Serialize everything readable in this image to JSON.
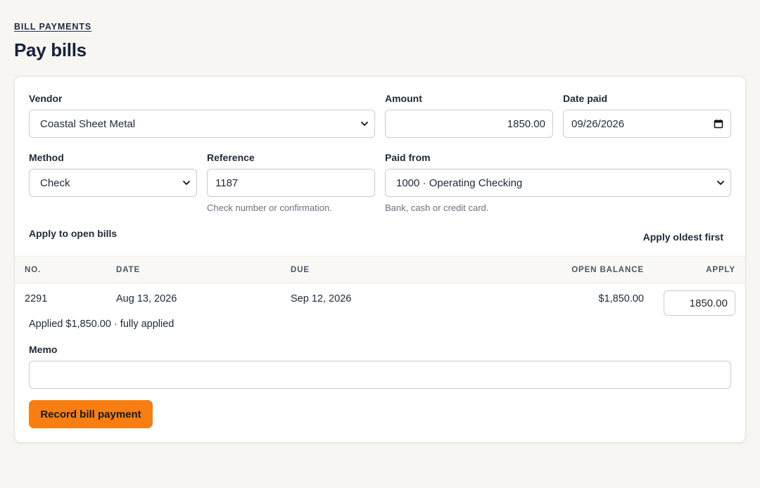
{
  "header": {
    "eyebrow": "BILL PAYMENTS",
    "title": "Pay bills"
  },
  "form": {
    "vendor": {
      "label": "Vendor",
      "value": "Coastal Sheet Metal"
    },
    "amount": {
      "label": "Amount",
      "value": "1850.00"
    },
    "date_paid": {
      "label": "Date paid",
      "value": "09/26/2026"
    },
    "method": {
      "label": "Method",
      "value": "Check"
    },
    "reference": {
      "label": "Reference",
      "value": "1187",
      "hint": "Check number or confirmation."
    },
    "paid_from": {
      "label": "Paid from",
      "value": "1000 · Operating Checking",
      "hint": "Bank, cash or credit card."
    },
    "memo": {
      "label": "Memo",
      "value": ""
    }
  },
  "bills": {
    "section_title": "Apply to open bills",
    "apply_oldest_label": "Apply oldest first",
    "columns": [
      "NO.",
      "DATE",
      "DUE",
      "OPEN BALANCE",
      "APPLY"
    ],
    "rows": [
      {
        "no": "2291",
        "date": "Aug 13, 2026",
        "due": "Sep 12, 2026",
        "open_balance": "$1,850.00",
        "apply": "1850.00"
      }
    ],
    "applied_note": "Applied $1,850.00 · fully applied"
  },
  "actions": {
    "record_label": "Record bill payment"
  },
  "colors": {
    "primary": "#f97e12",
    "page_bg": "#f7f6f2",
    "heading": "#17223b"
  }
}
